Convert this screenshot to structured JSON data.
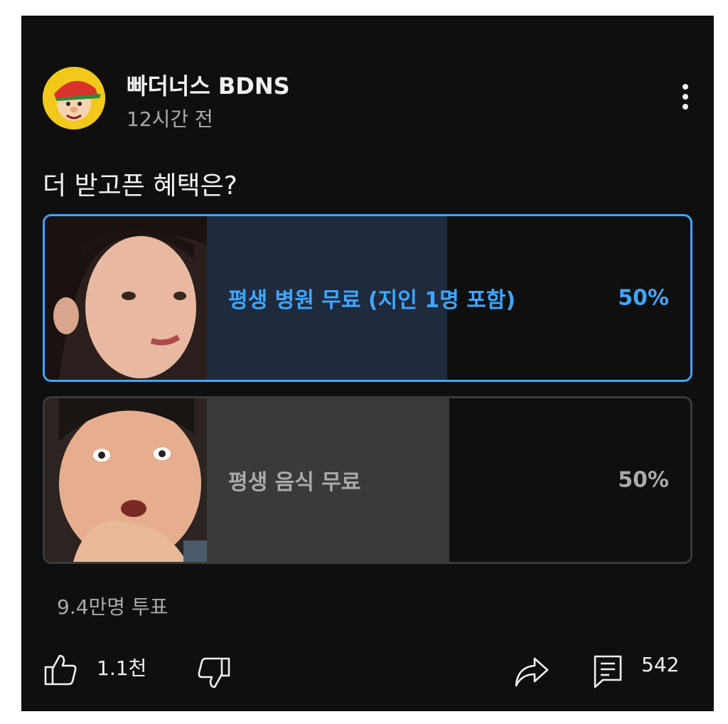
{
  "post": {
    "channel_name": "빠더너스 BDNS",
    "time_ago": "12시간 전",
    "question": "더 받고픈 혜택은?"
  },
  "poll": {
    "options": [
      {
        "label": "평생 병원 무료 (지인 1명 포함)",
        "percent_text": "50%",
        "percent": 50,
        "selected": true
      },
      {
        "label": "평생 음식 무료",
        "percent_text": "50%",
        "percent": 50,
        "selected": false
      }
    ],
    "vote_count": "9.4만명 투표"
  },
  "actions": {
    "like_count": "1.1천",
    "comment_count": "542"
  },
  "icons": [
    "avatar",
    "more-vert-icon",
    "thumbs-up-icon",
    "thumbs-down-icon",
    "share-icon",
    "comment-icon"
  ],
  "colors": {
    "accent": "#3ea6ff",
    "background": "#0f0f0f",
    "text": "#f1f1f1",
    "muted": "#aaaaaa"
  }
}
